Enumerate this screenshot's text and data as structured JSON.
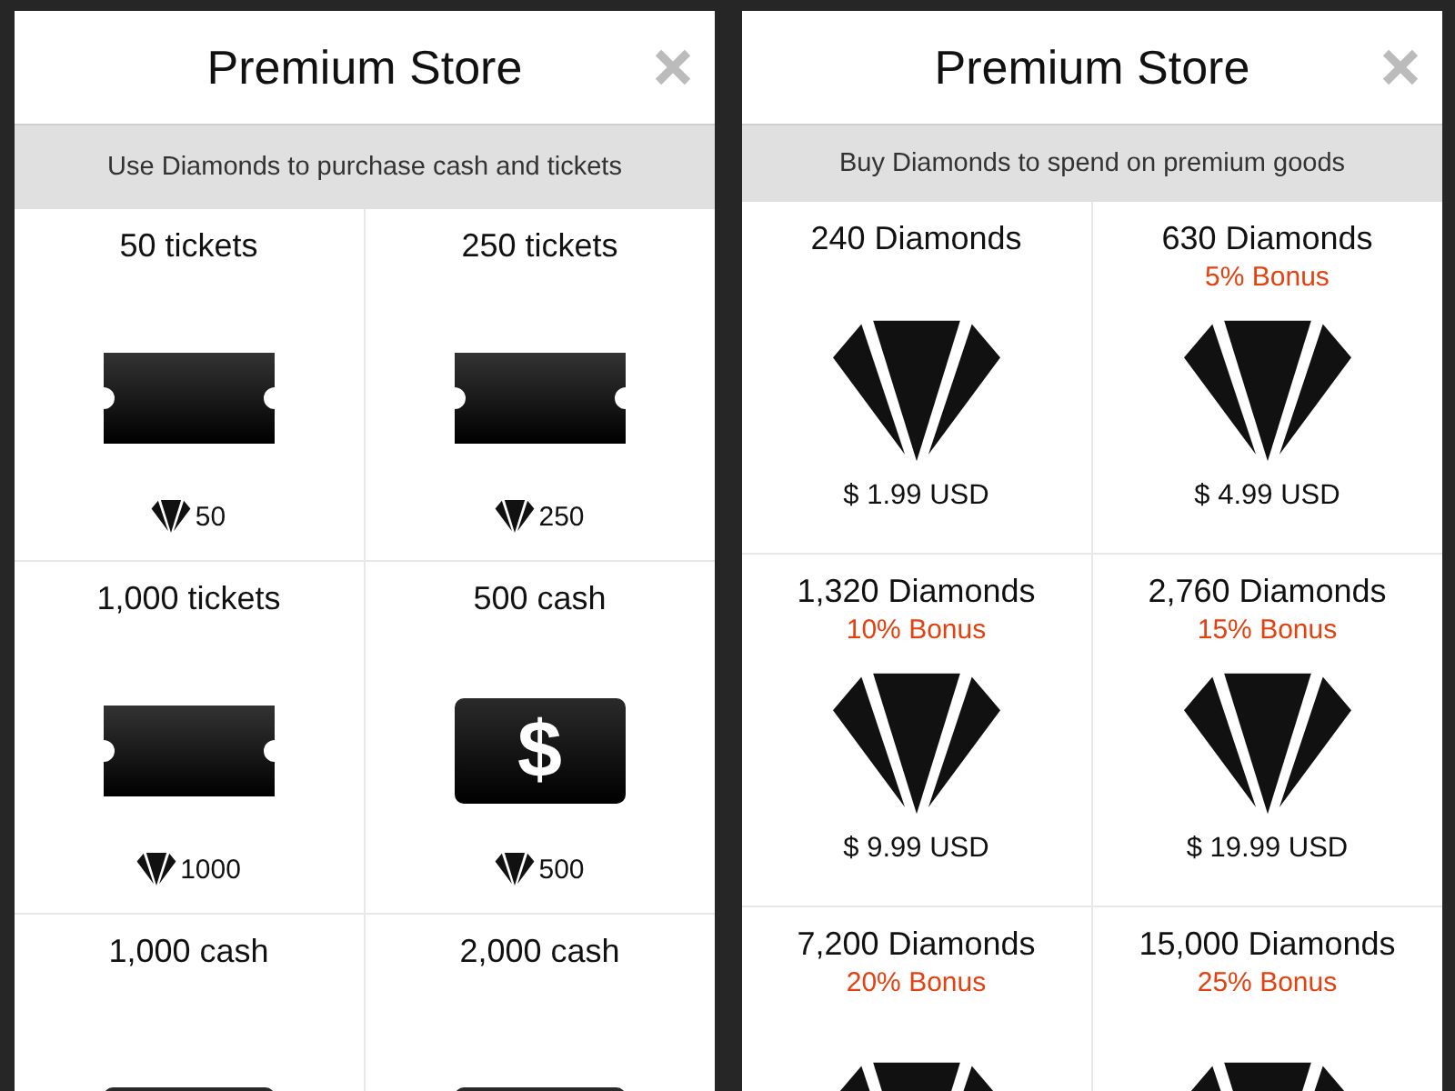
{
  "panels": [
    {
      "title": "Premium Store",
      "subtitle": "Use Diamonds to purchase cash and tickets",
      "items": [
        {
          "kind": "ticket",
          "name": "50 tickets",
          "cost": "50"
        },
        {
          "kind": "ticket",
          "name": "250 tickets",
          "cost": "250"
        },
        {
          "kind": "ticket",
          "name": "1,000 tickets",
          "cost": "1000"
        },
        {
          "kind": "cash",
          "name": "500 cash",
          "symbol": "$",
          "cost": "500"
        },
        {
          "kind": "cash",
          "name": "1,000 cash"
        },
        {
          "kind": "cash",
          "name": "2,000 cash"
        }
      ]
    },
    {
      "title": "Premium Store",
      "subtitle": "Buy Diamonds to spend on premium goods",
      "items": [
        {
          "kind": "diamond",
          "name": "240 Diamonds",
          "price": "$ 1.99 USD"
        },
        {
          "kind": "diamond",
          "name": "630 Diamonds",
          "bonus": "5% Bonus",
          "price": "$ 4.99 USD"
        },
        {
          "kind": "diamond",
          "name": "1,320 Diamonds",
          "bonus": "10% Bonus",
          "price": "$ 9.99 USD"
        },
        {
          "kind": "diamond",
          "name": "2,760 Diamonds",
          "bonus": "15% Bonus",
          "price": "$ 19.99 USD"
        },
        {
          "kind": "diamond",
          "name": "7,200 Diamonds",
          "bonus": "20% Bonus"
        },
        {
          "kind": "diamond",
          "name": "15,000 Diamonds",
          "bonus": "25% Bonus"
        }
      ]
    }
  ]
}
